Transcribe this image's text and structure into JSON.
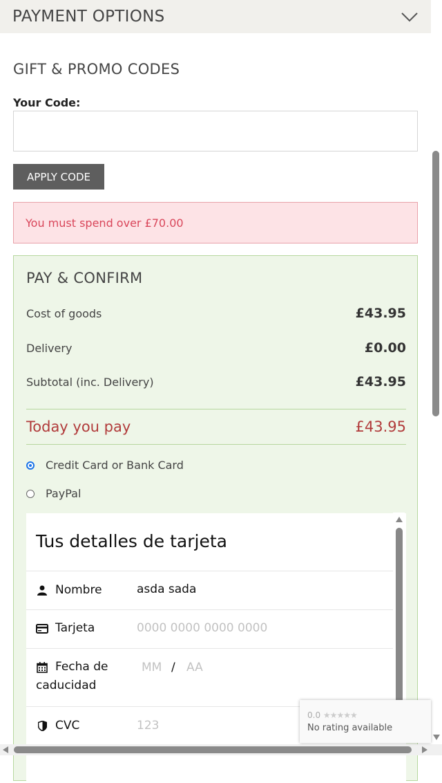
{
  "header": {
    "title": "PAYMENT OPTIONS"
  },
  "gift": {
    "title": "GIFT & PROMO CODES",
    "code_label": "Your Code:",
    "code_value": "",
    "apply_label": "APPLY CODE",
    "error": "You must spend over £70.00"
  },
  "pay": {
    "title": "PAY & CONFIRM",
    "rows": [
      {
        "label": "Cost of goods",
        "value": "£43.95"
      },
      {
        "label": "Delivery",
        "value": "£0.00"
      },
      {
        "label": "Subtotal (inc. Delivery)",
        "value": "£43.95"
      }
    ],
    "today_label": "Today you pay",
    "today_value": "£43.95",
    "methods": [
      {
        "label": "Credit Card or Bank Card",
        "selected": true
      },
      {
        "label": "PayPal",
        "selected": false
      }
    ]
  },
  "card": {
    "title": "Tus detalles de tarjeta",
    "name_label": "Nombre",
    "name_value": "asda sada",
    "card_label": "Tarjeta",
    "card_placeholder": "0000 0000 0000 0000",
    "expiry_label_1": "Fecha de",
    "expiry_label_2": "caducidad",
    "expiry_month_placeholder": "MM",
    "expiry_sep": "/",
    "expiry_year_placeholder": "AA",
    "cvc_label": "CVC",
    "cvc_placeholder": "123"
  },
  "rating": {
    "score": "0.0",
    "stars": "★★★★★",
    "text": "No rating available"
  },
  "colors": {
    "accent_red": "#b13b3b",
    "error_text": "#d9465a",
    "confirm_bg": "#eef6e8",
    "button_bg": "#5e5e5e",
    "radio_blue": "#1a73e8"
  }
}
